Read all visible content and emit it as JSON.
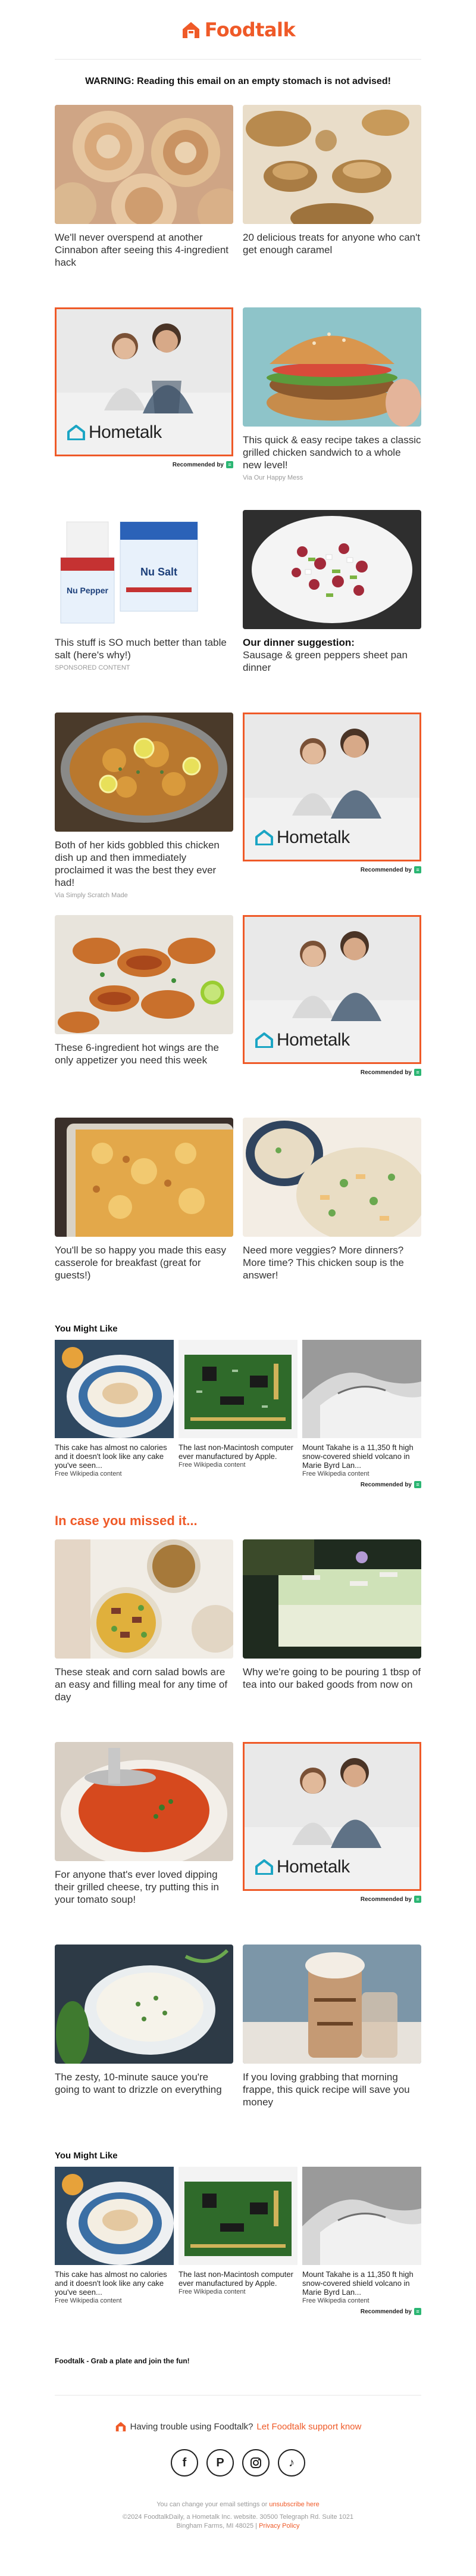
{
  "brand": {
    "name": "Foodtalk",
    "accent": "#ef5a28"
  },
  "warning": "WARNING: Reading this email on an empty stomach is not advised!",
  "rows1": [
    {
      "title": "We'll never overspend at another Cinnabon after seeing this 4-ingredient hack",
      "meta": ""
    },
    {
      "title": "20 delicious treats for anyone who can't get enough caramel",
      "meta": ""
    },
    {
      "ad": true,
      "brand": "Hometalk",
      "rec": "Recommended by"
    },
    {
      "title": "This quick & easy recipe takes a classic grilled chicken sandwich to a whole new level!",
      "meta": "Via Our Happy Mess"
    },
    {
      "title": "This stuff is SO much better than table salt (here's why!)",
      "meta": "SPONSORED CONTENT",
      "product_labels": [
        "Nu Pepper",
        "Nu Salt"
      ]
    },
    {
      "title_bold": "Our dinner suggestion:",
      "title": "Sausage & green peppers sheet pan dinner",
      "meta": ""
    },
    {
      "title": "Both of her kids gobbled this chicken dish up and then immediately proclaimed it was the best they ever had!",
      "meta": "Via Simply Scratch Made"
    },
    {
      "ad": true,
      "brand": "Hometalk",
      "rec": "Recommended by"
    },
    {
      "title": "These 6-ingredient hot wings are the only appetizer you need this week",
      "meta": ""
    },
    {
      "ad": true,
      "brand": "Hometalk",
      "rec": "Recommended by"
    },
    {
      "title": "You'll be so happy you made this easy casserole for breakfast (great for guests!)",
      "meta": ""
    },
    {
      "title": "Need more veggies? More dinners? More time? This chicken soup is the answer!",
      "meta": ""
    }
  ],
  "you_might_like": {
    "title": "You Might Like",
    "rec": "Recommended by",
    "items": [
      {
        "title": "This cake has almost no calories and it doesn't look like any cake you've seen...",
        "source": "Free Wikipedia content"
      },
      {
        "title": "The last non-Macintosh computer ever manufactured by Apple.",
        "source": "Free Wikipedia content"
      },
      {
        "title": "Mount Takahe is a 11,350 ft high snow-covered shield volcano in Marie Byrd Lan...",
        "source": "Free Wikipedia content"
      }
    ]
  },
  "missed": {
    "title": "In case you missed it..."
  },
  "rows2": [
    {
      "title": "These steak and corn salad bowls are an easy and filling meal for any time of day",
      "meta": ""
    },
    {
      "title": "Why we're going to be pouring 1 tbsp of tea into our baked goods from now on",
      "meta": ""
    },
    {
      "title": "For anyone that's ever loved dipping their grilled cheese, try putting this in your tomato soup!",
      "meta": ""
    },
    {
      "ad": true,
      "brand": "Hometalk",
      "rec": "Recommended by"
    },
    {
      "title": "The zesty, 10-minute sauce you're going to want to drizzle on everything",
      "meta": ""
    },
    {
      "title": "If you loving grabbing that morning frappe, this quick recipe will save you money",
      "meta": ""
    }
  ],
  "footer": {
    "tagline": "Foodtalk - Grab a plate and join the fun!",
    "support_text": "Having trouble using Foodtalk?",
    "support_link": "Let Foodtalk support know",
    "socials": [
      "facebook-icon",
      "pinterest-icon",
      "instagram-icon",
      "tiktok-icon"
    ],
    "settings_text": "You can change your email settings or",
    "unsubscribe": "unsubscribe here",
    "address": "©2024 FoodtalkDaily, a Hometalk Inc. website. 30500 Telegraph Rd. Suite 1021",
    "address2": "Bingham Farms, MI 48025",
    "privacy": "Privacy Policy"
  }
}
